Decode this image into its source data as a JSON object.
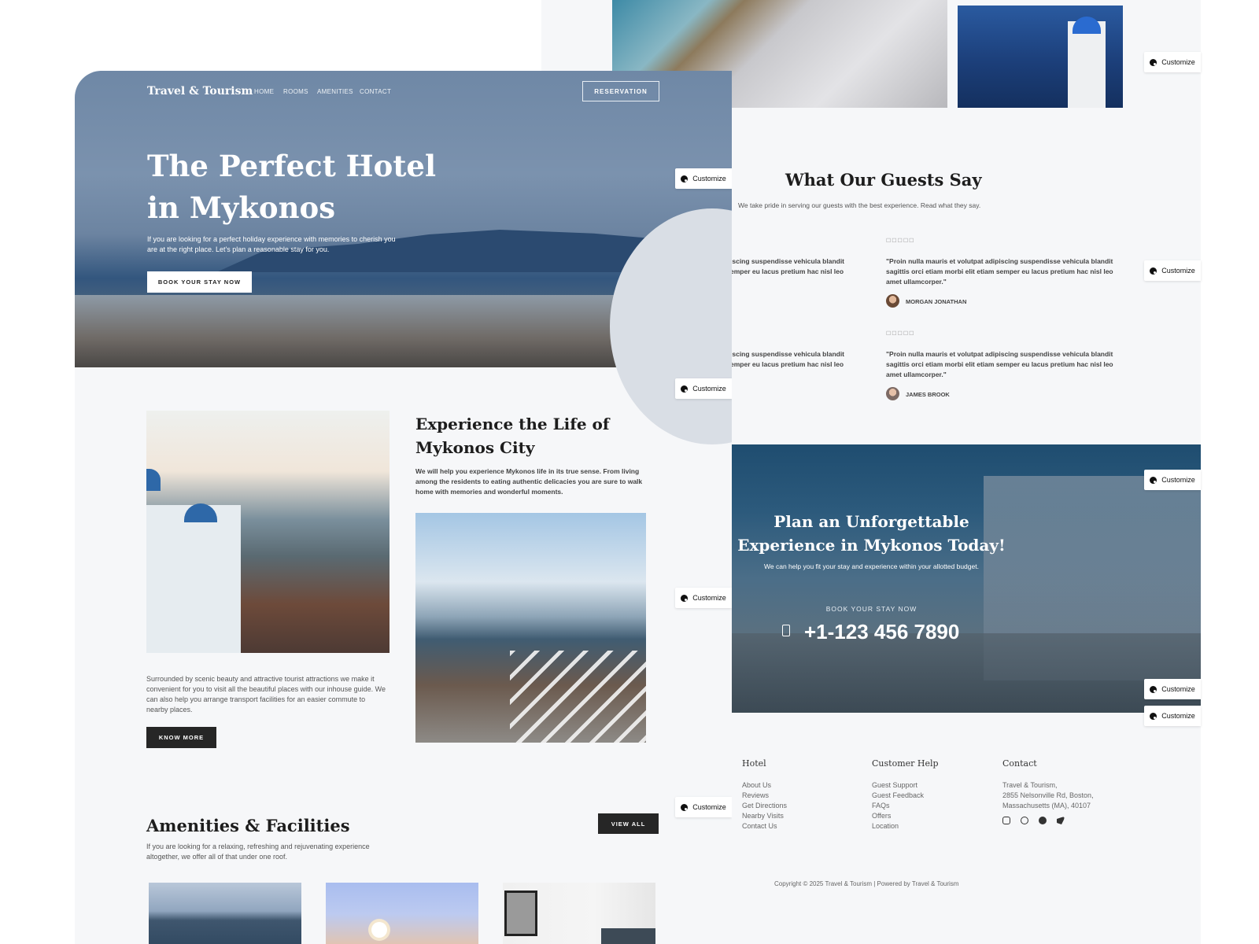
{
  "nav": {
    "logo": "Travel & Tourism",
    "links": [
      "HOME",
      "ROOMS",
      "AMENITIES",
      "CONTACT"
    ],
    "reservation": "RESERVATION"
  },
  "hero": {
    "title": "The Perfect Hotel in Mykonos",
    "text": "If you are looking for a perfect holiday experience with memories to cherish you are at the right place. Let's plan a reasonable stay for you.",
    "cta": "BOOK YOUR STAY NOW"
  },
  "customize_label": "Customize",
  "experience": {
    "title": "Experience the Life of Mykonos City",
    "lead": "We will help you experience Mykonos life in its true sense. From living among the residents to eating authentic delicacies you are sure to walk home with memories and wonderful moments.",
    "text": "Surrounded by scenic beauty and attractive tourist attractions we make it convenient for you to visit all the beautiful places with our inhouse guide. We can also help you arrange transport facilities for an easier commute to nearby places.",
    "cta": "KNOW MORE"
  },
  "amenities": {
    "title": "Amenities & Facilities",
    "text": "If you are looking for a relaxing, refreshing and rejuvenating experience altogether, we offer all of that under one roof.",
    "cta": "VIEW ALL"
  },
  "testimonials": {
    "title": "What Our Guests Say",
    "subtitle": "We take pride in serving our guests with the best experience. Read what they say.",
    "partial_line1": "iscing suspendisse vehicula blandit",
    "partial_line2": "emper eu lacus pretium hac nisl leo",
    "items": [
      {
        "quote": "\"Proin nulla mauris et volutpat adipiscing suspendisse vehicula blandit sagittis orci etiam morbi elit etiam semper eu lacus pretium hac nisl leo amet ullamcorper.\"",
        "name": "MORGAN JONATHAN"
      },
      {
        "quote": "\"Proin nulla mauris et volutpat adipiscing suspendisse vehicula blandit sagittis orci etiam morbi elit etiam semper eu lacus pretium hac nisl leo amet ullamcorper.\"",
        "name": "JAMES BROOK"
      }
    ]
  },
  "plan": {
    "title": "Plan an Unforgettable Experience in Mykonos Today!",
    "text": "We can help you fit your stay and experience within your allotted budget.",
    "label": "BOOK YOUR STAY NOW",
    "phone": "+1-123 456 7890"
  },
  "footer": {
    "hotel": {
      "title": "Hotel",
      "links": [
        "About Us",
        "Reviews",
        "Get Directions",
        "Nearby Visits",
        "Contact Us"
      ]
    },
    "help": {
      "title": "Customer Help",
      "links": [
        "Guest Support",
        "Guest Feedback",
        "FAQs",
        "Offers",
        "Location"
      ]
    },
    "contact": {
      "title": "Contact",
      "lines": [
        "Travel & Tourism,",
        "2855 Nelsonville Rd, Boston,",
        "Massachusetts (MA), 40107"
      ]
    },
    "social_icons": [
      "instagram-icon",
      "tripadvisor-icon",
      "facebook-icon",
      "twitter-icon"
    ],
    "copyright": "Copyright © 2025 Travel & Tourism | Powered by Travel & Tourism"
  },
  "colors": {
    "panel": "#f6f7f9",
    "dark_button": "#262626",
    "hero_sky": "#6f88a6"
  }
}
